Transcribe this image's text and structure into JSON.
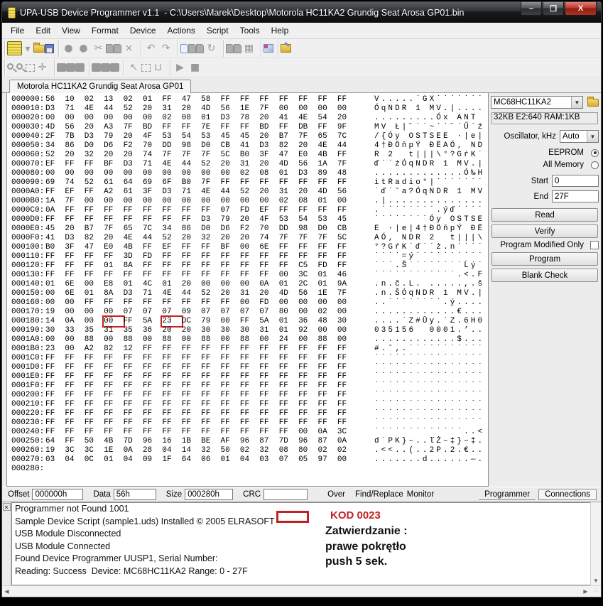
{
  "window": {
    "title": "UPA-USB Device Programmer v1.1  - C:\\Users\\Marek\\Desktop\\Motorola HC11KA2 Grundig Seat Arosa GP01.bin",
    "minimize": "–",
    "maximize": "❐",
    "close": "X"
  },
  "menu": {
    "items": [
      "File",
      "Edit",
      "View",
      "Format",
      "Device",
      "Actions",
      "Script",
      "Tools",
      "Help"
    ]
  },
  "toolbar1": {
    "groups": [
      [
        {
          "name": "device-chip-icon",
          "kind": "chip"
        },
        {
          "name": "chip-dropdown-caret-icon",
          "glyph": "▾",
          "kind": "small"
        },
        {
          "name": "open-file-icon",
          "kind": "folder"
        },
        {
          "name": "save-file-icon",
          "kind": "floppy"
        }
      ],
      [
        {
          "name": "record-icon",
          "glyph": "●"
        },
        {
          "name": "record-alt-icon",
          "glyph": "●"
        },
        {
          "name": "cut-icon",
          "glyph": "✂"
        },
        {
          "name": "copy-icon",
          "kind": "pagei"
        },
        {
          "name": "paste-icon",
          "kind": "pagei"
        },
        {
          "name": "delete-icon",
          "glyph": "×"
        }
      ],
      [
        {
          "name": "undo-icon",
          "glyph": "↶"
        },
        {
          "name": "redo-icon",
          "glyph": "↷"
        }
      ],
      [
        {
          "name": "new-doc-icon",
          "kind": "pageblue"
        },
        {
          "name": "doc-gray-icon",
          "kind": "pagei"
        },
        {
          "name": "doc-gray2-icon",
          "kind": "pagei"
        },
        {
          "name": "refresh-icon",
          "glyph": "↻"
        }
      ],
      [
        {
          "name": "doc-gray3-icon",
          "kind": "pagei"
        },
        {
          "name": "doc-gray4-icon",
          "kind": "pagei"
        },
        {
          "name": "grid-icon",
          "glyph": "▦"
        }
      ],
      [
        {
          "name": "package-icon",
          "kind": "package"
        }
      ],
      [
        {
          "name": "settings-tools-icon",
          "kind": "tools"
        }
      ]
    ]
  },
  "toolbar2": {
    "groups": [
      [
        {
          "name": "zoom-in-icon",
          "kind": "mag"
        },
        {
          "name": "zoom-out-icon",
          "kind": "mag"
        },
        {
          "name": "select-region-icon",
          "kind": "dash"
        },
        {
          "name": "move-icon",
          "glyph": "✛"
        }
      ],
      [
        {
          "name": "block1-icon",
          "kind": "sq"
        },
        {
          "name": "block2-icon",
          "kind": "sq"
        },
        {
          "name": "block3-icon",
          "kind": "sq"
        }
      ],
      [
        {
          "name": "block4-icon",
          "kind": "sq"
        },
        {
          "name": "block5-icon",
          "kind": "sq"
        },
        {
          "name": "block6-icon",
          "kind": "sq"
        }
      ],
      [
        {
          "name": "pointer-icon",
          "glyph": "↖"
        },
        {
          "name": "find-selection-icon",
          "kind": "dash"
        },
        {
          "name": "bucket-icon",
          "glyph": "⊔"
        }
      ],
      [
        {
          "name": "run-icon",
          "glyph": "▶"
        },
        {
          "name": "stop-icon",
          "glyph": "■"
        }
      ]
    ]
  },
  "tab": {
    "label": "Motorola HC11KA2 Grundig Seat Arosa GP01"
  },
  "hex": {
    "highlight_color": "#cc1f1f",
    "rows": [
      {
        "addr": "000000:",
        "bytes": "56 10 02 13 02 01 FF 47 58 FF FF FF FF FF FF FF",
        "ascii": "V.....˙GX˙˙˙˙˙˙˙"
      },
      {
        "addr": "000010:",
        "bytes": "D3 71 4E 44 52 20 31 20 4D 56 1E 7F 00 00 00 00",
        "ascii": "ÓqNDR 1 MV.|...."
      },
      {
        "addr": "000020:",
        "bytes": "00 00 00 00 00 00 02 08 01 D3 78 20 41 4E 54 20",
        "ascii": ".........Óx ANT "
      },
      {
        "addr": "000030:",
        "bytes": "4D 56 20 A3 7F BD FF FF 7E FF FF BD FF DB FF 9F",
        "ascii": "MV Ł|˝˙˙~˙˙˝˙Ű˙ź"
      },
      {
        "addr": "000040:",
        "bytes": "2F 7B D3 79 20 4F 53 54 53 45 45 20 B7 7F 65 7C",
        "ascii": "/{Óy OSTSEE ·|e|"
      },
      {
        "addr": "000050:",
        "bytes": "34 86 D0 D6 F2 70 DD 98 D0 CB 41 D3 82 20 4E 44",
        "ascii": "4†ĐÖňpÝ ĐËAÓ‚ ND"
      },
      {
        "addr": "000060:",
        "bytes": "52 20 32 20 20 74 7F 7F 7F 5C B0 3F 47 E0 4B FF",
        "ascii": "R 2  t|||\\°?GŕK˙"
      },
      {
        "addr": "000070:",
        "bytes": "EF FF FF BF D3 71 4E 44 52 20 31 20 4D 56 1A 7F",
        "ascii": "ď˙˙żÓqNDR 1 MV.|"
      },
      {
        "addr": "000080:",
        "bytes": "00 00 00 00 00 00 00 00 00 00 02 08 01 D3 89 48",
        "ascii": ".............Ó‰H"
      },
      {
        "addr": "000090:",
        "bytes": "69 74 52 61 64 69 6F B0 7F FF FF FF FF FF FF FF",
        "ascii": "itRadio°|˙˙˙˙˙˙˙"
      },
      {
        "addr": "0000A0:",
        "bytes": "FF EF FF A2 61 3F D3 71 4E 44 52 20 31 20 4D 56",
        "ascii": "˙ď˙˘a?ÓqNDR 1 MV"
      },
      {
        "addr": "0000B0:",
        "bytes": "1A 7F 00 00 00 00 00 00 00 00 00 00 02 08 01 00",
        "ascii": ".|.............."
      },
      {
        "addr": "0000C0:",
        "bytes": "0A FF FF FF FF FF FF FF FF 07 FD EF FF FF FF FF",
        "ascii": ".˙˙˙˙˙˙˙˙.ýď˙˙˙˙"
      },
      {
        "addr": "0000D0:",
        "bytes": "FF FF FF FF FF FF FF FF D3 79 20 4F 53 54 53 45",
        "ascii": "˙˙˙˙˙˙˙˙Óy OSTSE"
      },
      {
        "addr": "0000E0:",
        "bytes": "45 20 B7 7F 65 7C 34 86 D0 D6 F2 70 DD 98 D0 CB",
        "ascii": "E ·|e|4†ĐÖňpÝ ĐË"
      },
      {
        "addr": "0000F0:",
        "bytes": "41 D3 82 20 4E 44 52 20 32 20 20 74 7F 7F 7F 5C",
        "ascii": "AÓ‚ NDR 2  t|||\\"
      },
      {
        "addr": "000100:",
        "bytes": "B0 3F 47 E0 4B FF EF FF FF BF 00 6E FF FF FF FF",
        "ascii": "°?GŕK˙ď˙˙ż.n˙˙˙˙"
      },
      {
        "addr": "000110:",
        "bytes": "FF FF FF FF 3D FD FF FF FF FF FF FF FF FF FF FF",
        "ascii": "˙˙˙˙=ý˙˙˙˙˙˙˙˙˙˙"
      },
      {
        "addr": "000120:",
        "bytes": "FF FF FF 01 8A FF FF FF FF FF FF FF FF C5 FD FF",
        "ascii": "˙˙˙.Š˙˙˙˙˙˙˙˙Ĺý˙"
      },
      {
        "addr": "000130:",
        "bytes": "FF FF FF FF FF FF FF FF FF FF FF FF 00 3C 01 46",
        "ascii": "˙˙˙˙˙˙˙˙˙˙˙˙.<.F"
      },
      {
        "addr": "000140:",
        "bytes": "01 6E 00 E8 01 4C 01 20 00 00 00 0A 01 2C 01 9A",
        "ascii": ".n.č.L. .....,.š"
      },
      {
        "addr": "000150:",
        "bytes": "00 6E 01 8A D3 71 4E 44 52 20 31 20 4D 56 1E 7F",
        "ascii": ".n.ŠÓqNDR 1 MV.|"
      },
      {
        "addr": "000160:",
        "bytes": "00 00 FF FF FF FF FF FF FF FF 00 FD 00 00 00 00",
        "ascii": "..˙˙˙˙˙˙˙˙.ý...."
      },
      {
        "addr": "000170:",
        "bytes": "19 00 00 00 07 07 07 09 07 07 07 07 80 00 02 00",
        "ascii": "............€..."
      },
      {
        "addr": "000180:",
        "bytes": "14 0A 00 00 FF 5A 23 DC 79 00 FF 5A 01 36 48 30",
        "ascii": "....˙Z#Üy.˙Z.6H0",
        "hl": [
          3,
          6
        ]
      },
      {
        "addr": "000190:",
        "bytes": "30 33 35 31 35 36 20 20 30 30 30 31 01 92 00 00",
        "ascii": "035156  0001.’.."
      },
      {
        "addr": "0001A0:",
        "bytes": "00 00 88 00 88 00 88 00 88 00 88 00 24 00 88 00",
        "ascii": "............$..."
      },
      {
        "addr": "0001B0:",
        "bytes": "23 00 A2 82 12 FF FF FF FF FF FF FF FF FF FF FF",
        "ascii": "#.˘‚.˙˙˙˙˙˙˙˙˙˙˙"
      },
      {
        "addr": "0001C0:",
        "bytes": "FF FF FF FF FF FF FF FF FF FF FF FF FF FF FF FF",
        "ascii": "˙˙˙˙˙˙˙˙˙˙˙˙˙˙˙˙"
      },
      {
        "addr": "0001D0:",
        "bytes": "FF FF FF FF FF FF FF FF FF FF FF FF FF FF FF FF",
        "ascii": "˙˙˙˙˙˙˙˙˙˙˙˙˙˙˙˙"
      },
      {
        "addr": "0001E0:",
        "bytes": "FF FF FF FF FF FF FF FF FF FF FF FF FF FF FF FF",
        "ascii": "˙˙˙˙˙˙˙˙˙˙˙˙˙˙˙˙"
      },
      {
        "addr": "0001F0:",
        "bytes": "FF FF FF FF FF FF FF FF FF FF FF FF FF FF FF FF",
        "ascii": "˙˙˙˙˙˙˙˙˙˙˙˙˙˙˙˙"
      },
      {
        "addr": "000200:",
        "bytes": "FF FF FF FF FF FF FF FF FF FF FF FF FF FF FF FF",
        "ascii": "˙˙˙˙˙˙˙˙˙˙˙˙˙˙˙˙"
      },
      {
        "addr": "000210:",
        "bytes": "FF FF FF FF FF FF FF FF FF FF FF FF FF FF FF FF",
        "ascii": "˙˙˙˙˙˙˙˙˙˙˙˙˙˙˙˙"
      },
      {
        "addr": "000220:",
        "bytes": "FF FF FF FF FF FF FF FF FF FF FF FF FF FF FF FF",
        "ascii": "˙˙˙˙˙˙˙˙˙˙˙˙˙˙˙˙"
      },
      {
        "addr": "000230:",
        "bytes": "FF FF FF FF FF FF FF FF FF FF FF FF FF FF FF FF",
        "ascii": "˙˙˙˙˙˙˙˙˙˙˙˙˙˙˙˙"
      },
      {
        "addr": "000240:",
        "bytes": "FF FF FF FF FF FF FF FF FF FF FF FF FF 00 0A 3C",
        "ascii": "˙˙˙˙˙˙˙˙˙˙˙˙˙..<"
      },
      {
        "addr": "000250:",
        "bytes": "64 FF 50 4B 7D 96 16 1B BE AF 96 87 7D 96 87 0A",
        "ascii": "d˙PK}–..ľŻ–‡}–‡."
      },
      {
        "addr": "000260:",
        "bytes": "19 3C 3C 1E 0A 28 04 14 32 50 02 32 08 80 02 02",
        "ascii": ".<<..(..2P.2.€.."
      },
      {
        "addr": "000270:",
        "bytes": "03 04 0C 01 04 09 1F 64 06 01 04 03 07 05 97 00",
        "ascii": ".......d......—."
      },
      {
        "addr": "000280:",
        "bytes": "",
        "ascii": ""
      }
    ]
  },
  "device_panel": {
    "device": "MC68HC11KA2",
    "device_info": "32KB E2:640 RAM:1KB",
    "oscillator_label": "Oscillator, kHz",
    "oscillator_value": "Auto",
    "radio_eeprom": "EEPROM",
    "radio_all_memory": "All Memory",
    "start_label": "Start",
    "start_value": "0",
    "end_label": "End",
    "end_value": "27F",
    "read_button": "Read",
    "verify_button": "Verify",
    "program_modified_label": "Program Modified Only",
    "program_button": "Program",
    "blank_check_button": "Blank Check"
  },
  "status_bar": {
    "offset_label": "Offset",
    "offset_value": "000000h",
    "data_label": "Data",
    "data_value": "56h",
    "size_label": "Size",
    "size_value": "000280h",
    "crc_label": "CRC",
    "crc_value": "",
    "over_label": "Over",
    "find_replace_label": "Find/Replace",
    "monitor_label": "Monitor",
    "tab_programmer": "Programmer",
    "tab_connections": "Connections"
  },
  "log": {
    "close_label": "×",
    "lines": [
      "Programmer not Found 1001",
      "Sample Device Script (sample1.uds) Installed © 2005 ELRASOFT",
      "USB Module Disconnected",
      "USB Module Connected",
      "Found Device Programmer UUSP1, Serial Number:",
      "Reading: Success  Device: MC68HC11KA2 Range: 0 - 27F"
    ],
    "annotation": {
      "kod": "KOD 0023",
      "kod_color": "#c32222",
      "text": "Zatwierdzanie :\nprawe pokrętło\npush 5 sek."
    }
  }
}
